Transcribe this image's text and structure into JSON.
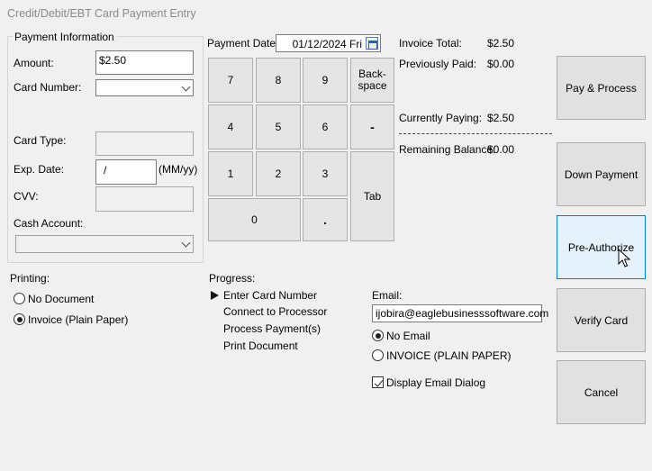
{
  "window": {
    "title": "Credit/Debit/EBT Card Payment Entry"
  },
  "payment_info": {
    "group_label": "Payment Information",
    "amount_label": "Amount:",
    "amount_value": "$2.50",
    "card_number_label": "Card Number:",
    "card_type_label": "Card Type:",
    "exp_date_label": "Exp. Date:",
    "exp_date_value": "/",
    "exp_date_hint": "(MM/yy)",
    "cvv_label": "CVV:",
    "cash_account_label": "Cash Account:"
  },
  "payment_date": {
    "label": "Payment Date:",
    "value": "01/12/2024 Fri"
  },
  "keypad": {
    "k7": "7",
    "k8": "8",
    "k9": "9",
    "backspace": "Back-\nspace",
    "k4": "4",
    "k5": "5",
    "k6": "6",
    "minus": "-",
    "k1": "1",
    "k2": "2",
    "k3": "3",
    "tab": "Tab",
    "k0": "0",
    "dot": "."
  },
  "summary": {
    "invoice_total_label": "Invoice Total:",
    "invoice_total_value": "$2.50",
    "previously_paid_label": "Previously Paid:",
    "previously_paid_value": "$0.00",
    "currently_paying_label": "Currently Paying:",
    "currently_paying_value": "$2.50",
    "remaining_balance_label": "Remaining Balance:",
    "remaining_balance_value": "$0.00"
  },
  "actions": {
    "pay_process": "Pay & Process",
    "down_payment": "Down Payment",
    "pre_authorize": "Pre-Authorize",
    "verify_card": "Verify Card",
    "cancel": "Cancel"
  },
  "printing": {
    "label": "Printing:",
    "no_document": "No Document",
    "invoice_plain": "Invoice (Plain Paper)",
    "selected": "invoice_plain"
  },
  "progress": {
    "label": "Progress:",
    "steps": [
      "Enter Card Number",
      "Connect to Processor",
      "Process Payment(s)",
      "Print Document"
    ],
    "current_step": 0
  },
  "email": {
    "label": "Email:",
    "value": "ijobira@eaglebusinesssoftware.com",
    "no_email": "No Email",
    "invoice_plain": "INVOICE (PLAIN PAPER)",
    "selected": "no_email",
    "display_dialog": "Display Email Dialog",
    "display_dialog_checked": true
  }
}
